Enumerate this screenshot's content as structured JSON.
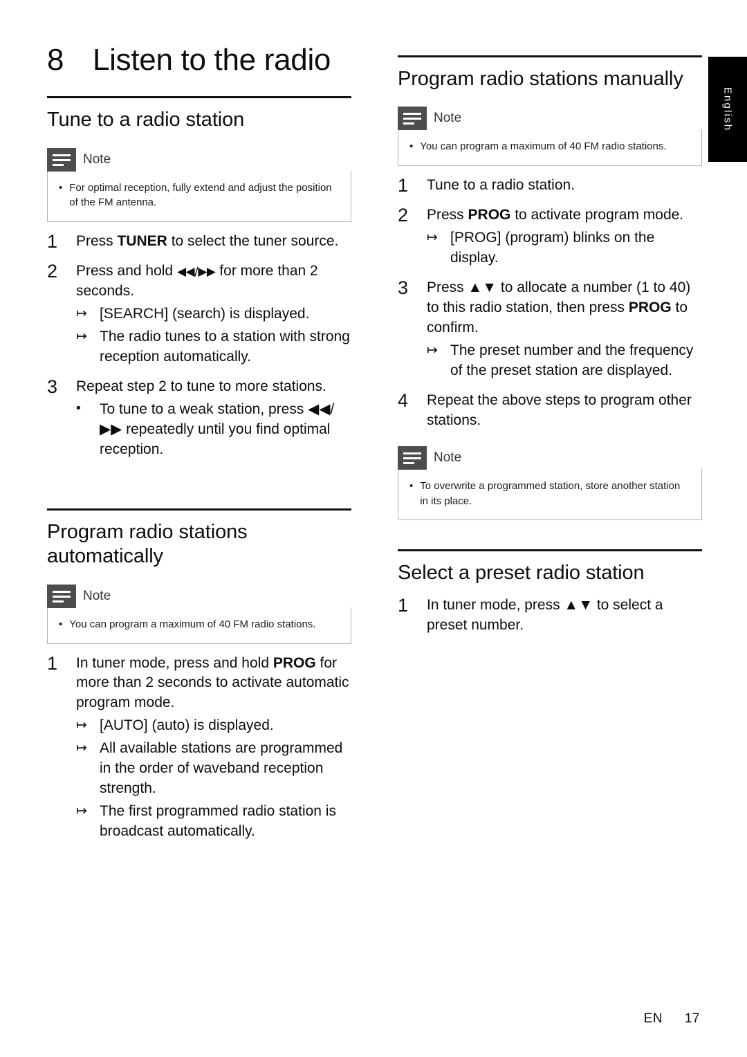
{
  "language_tab": "English",
  "chapter": {
    "number": "8",
    "title": "Listen to the radio"
  },
  "left_column": {
    "section1": {
      "heading": "Tune to a radio station",
      "note": {
        "label": "Note",
        "bullet": "•",
        "text": "For optimal reception, fully extend and adjust the position of the FM antenna."
      },
      "steps": [
        {
          "num": "1",
          "text_parts": [
            "Press ",
            "TUNER",
            " to select the tuner source."
          ],
          "bold_index": 1,
          "subs": []
        },
        {
          "num": "2",
          "text_parts": [
            "Press and hold ",
            "◀◀/▶▶",
            " for more than 2 seconds."
          ],
          "bold_index": -1,
          "subs": [
            {
              "marker": "↦",
              "text": "[SEARCH] (search) is displayed."
            },
            {
              "marker": "↦",
              "text": "The radio tunes to a station with strong reception automatically."
            }
          ]
        },
        {
          "num": "3",
          "text_parts": [
            "Repeat step 2 to tune to more stations."
          ],
          "bold_index": -1,
          "subs": [
            {
              "marker": "•",
              "text": "To tune to a weak station, press ◀◀/▶▶ repeatedly until you find optimal reception."
            }
          ]
        }
      ]
    },
    "section2": {
      "heading": "Program radio stations automatically",
      "note": {
        "label": "Note",
        "bullet": "•",
        "text": "You can program a maximum of 40 FM radio stations."
      },
      "steps": [
        {
          "num": "1",
          "text_parts": [
            "In tuner mode, press and hold ",
            "PROG",
            " for more than 2 seconds to activate automatic program mode."
          ],
          "bold_index": 1,
          "subs": [
            {
              "marker": "↦",
              "text": "[AUTO] (auto) is displayed."
            },
            {
              "marker": "↦",
              "text": "All available stations are programmed in the order of waveband reception strength."
            },
            {
              "marker": "↦",
              "text": "The first programmed radio station is broadcast automatically."
            }
          ]
        }
      ]
    }
  },
  "right_column": {
    "section1": {
      "heading": "Program radio stations manually",
      "note": {
        "label": "Note",
        "bullet": "•",
        "text": "You can program a maximum of 40 FM radio stations."
      },
      "steps": [
        {
          "num": "1",
          "text_parts": [
            "Tune to a radio station."
          ],
          "bold_index": -1,
          "subs": []
        },
        {
          "num": "2",
          "text_parts": [
            "Press ",
            "PROG",
            " to activate program mode."
          ],
          "bold_index": 1,
          "subs": [
            {
              "marker": "↦",
              "text": "[PROG] (program) blinks on the display."
            }
          ]
        },
        {
          "num": "3",
          "text_parts": [
            "Press ▲▼ to allocate a number (1 to 40) to this radio station, then press ",
            "PROG",
            " to confirm."
          ],
          "bold_index": 1,
          "subs": [
            {
              "marker": "↦",
              "text": "The preset number and the frequency of the preset station are displayed."
            }
          ]
        },
        {
          "num": "4",
          "text_parts": [
            "Repeat the above steps to program other stations."
          ],
          "bold_index": -1,
          "subs": []
        }
      ],
      "note2": {
        "label": "Note",
        "bullet": "•",
        "text": "To overwrite a programmed station, store another station in its place."
      }
    },
    "section2": {
      "heading": "Select a preset radio station",
      "steps": [
        {
          "num": "1",
          "text_parts": [
            "In tuner mode, press ▲▼ to select a preset number."
          ],
          "bold_index": -1,
          "subs": []
        }
      ]
    }
  },
  "footer": {
    "lang_code": "EN",
    "page_number": "17"
  }
}
